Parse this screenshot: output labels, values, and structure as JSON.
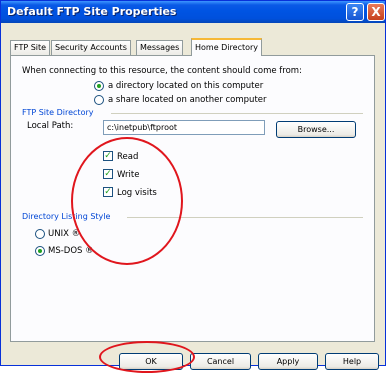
{
  "window": {
    "title": "Default FTP Site Properties"
  },
  "titlebar_buttons": {
    "help": "?",
    "close": "X"
  },
  "tabs": [
    {
      "label": "FTP Site"
    },
    {
      "label": "Security Accounts"
    },
    {
      "label": "Messages"
    },
    {
      "label": "Home Directory"
    }
  ],
  "home_directory": {
    "intro": "When connecting to this resource, the content should come from:",
    "source_options": [
      {
        "label": "a directory located on this computer",
        "selected": true
      },
      {
        "label": "a share located on another computer",
        "selected": false
      }
    ],
    "group_title": "FTP Site Directory",
    "local_path_label": "Local Path:",
    "local_path_value": "c:\\inetpub\\ftproot",
    "browse_label": "Browse...",
    "permissions": [
      {
        "label": "Read",
        "checked": true
      },
      {
        "label": "Write",
        "checked": true
      },
      {
        "label": "Log visits",
        "checked": true
      }
    ],
    "listing_group_title": "Directory Listing Style",
    "listing_options": [
      {
        "label": "UNIX ®",
        "selected": false
      },
      {
        "label": "MS-DOS ®",
        "selected": true
      }
    ]
  },
  "buttons": {
    "ok": "OK",
    "cancel": "Cancel",
    "apply": "Apply",
    "help": "Help"
  },
  "colors": {
    "annotation": "#e0161d",
    "titlebar": "#0054e3",
    "group_title": "#0046d5"
  }
}
